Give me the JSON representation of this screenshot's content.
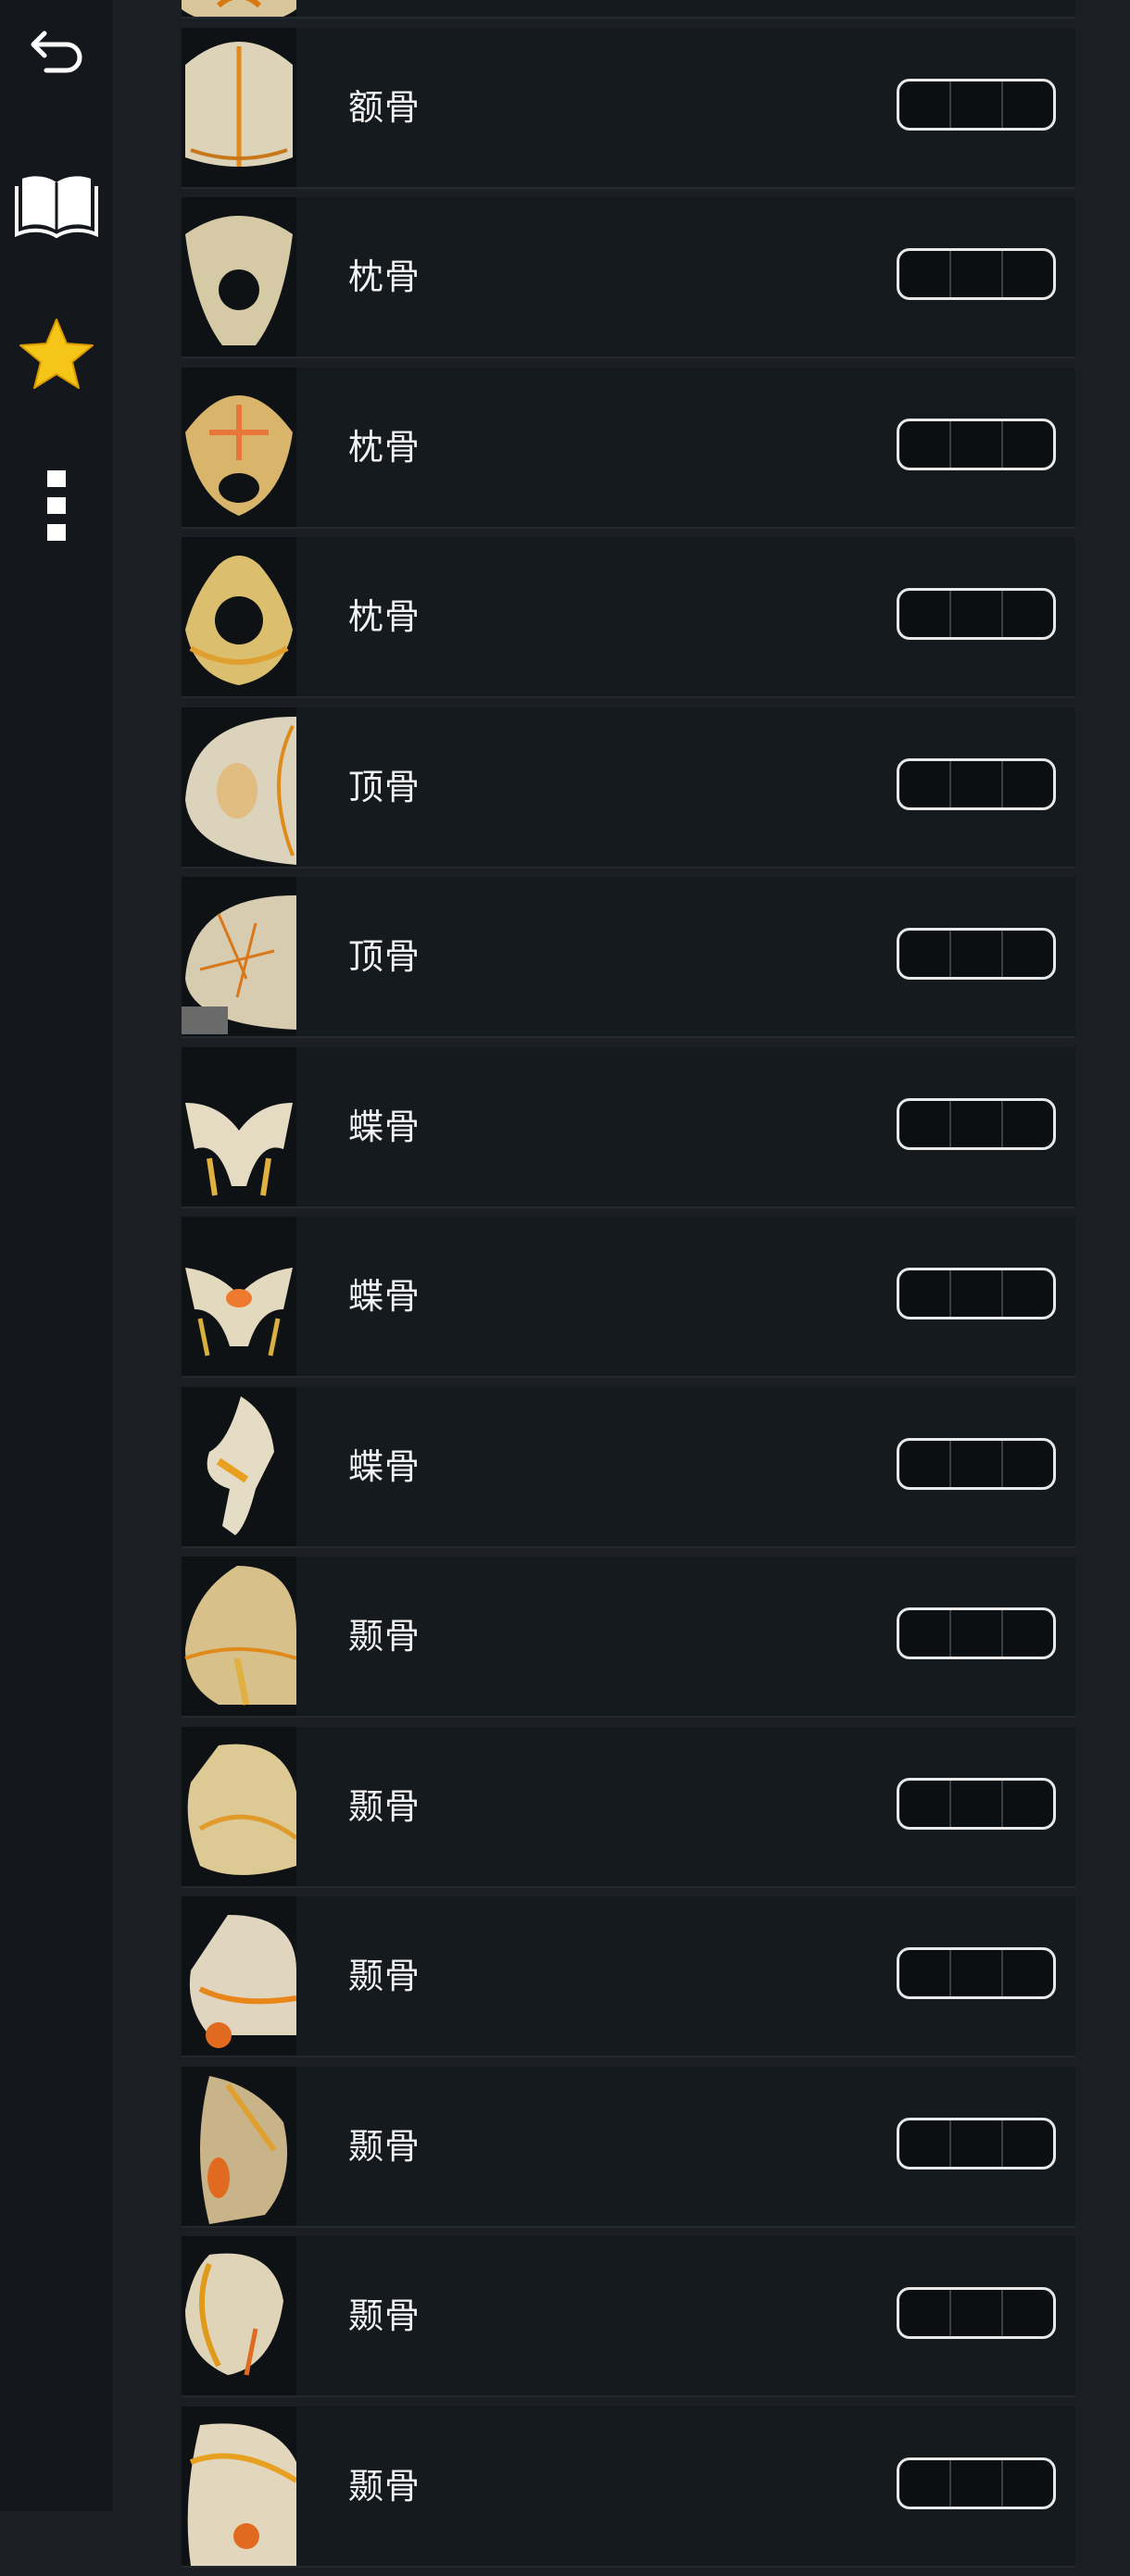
{
  "sidebar": {
    "back_icon": "back-arrow-icon",
    "book_icon": "open-book-icon",
    "favorite_icon": "star-icon",
    "more_icon": "vertical-dots-icon",
    "star_color": "#f5c518"
  },
  "list": {
    "items": [
      {
        "label": ""
      },
      {
        "label": "额骨"
      },
      {
        "label": "枕骨"
      },
      {
        "label": "枕骨"
      },
      {
        "label": "枕骨"
      },
      {
        "label": "顶骨"
      },
      {
        "label": "顶骨"
      },
      {
        "label": "蝶骨"
      },
      {
        "label": "蝶骨"
      },
      {
        "label": "蝶骨"
      },
      {
        "label": "颞骨"
      },
      {
        "label": "颞骨"
      },
      {
        "label": "颞骨"
      },
      {
        "label": "颞骨"
      },
      {
        "label": "颞骨"
      },
      {
        "label": "颞骨"
      }
    ]
  }
}
